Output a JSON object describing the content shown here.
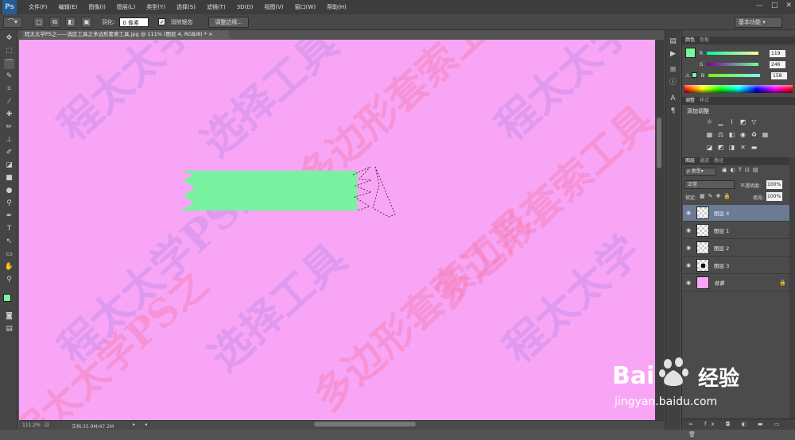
{
  "app": {
    "logo": "Ps"
  },
  "menu": [
    "文件(F)",
    "编辑(E)",
    "图像(I)",
    "图层(L)",
    "类型(Y)",
    "选择(S)",
    "滤镜(T)",
    "3D(D)",
    "视图(V)",
    "窗口(W)",
    "帮助(H)"
  ],
  "window_controls": [
    "—",
    "□",
    "✕"
  ],
  "options": {
    "feather_label": "羽化:",
    "feather_value": "0 像素",
    "antialias_label": "消除锯齿",
    "antialias_checked": true,
    "refine_edge_button": "调整边缘...",
    "workspace": "基本功能"
  },
  "document": {
    "tab_title": "程太太学PS之——选区工具之多边形套索工具.jpg @ 111% (图层 4, RGB/8) *",
    "close_icon": "×"
  },
  "canvas": {
    "background_color": "#f8a5f5",
    "shape_color": "#78f2a0",
    "watermark_texts": [
      "程太太学",
      "选择工具",
      "多边形套索工具",
      "程太太学PS之",
      "程太太学",
      "选择工具",
      "多边形套索工具",
      "程太太学",
      "多边形套索工具",
      "程太太学PS之"
    ]
  },
  "status": {
    "zoom": "111.2%",
    "doc_info": "文档:35.9M/47.2M"
  },
  "color_panel": {
    "tabs": [
      "颜色",
      "色板"
    ],
    "R": "119",
    "G": "246",
    "B": "158",
    "foreground": "#77f69e",
    "r_label": "R",
    "g_label": "G",
    "b_label": "B"
  },
  "adjust_panel": {
    "tabs": [
      "调整",
      "样式"
    ],
    "title": "添加调整"
  },
  "layers_panel": {
    "tabs": [
      "图层",
      "通道",
      "路径"
    ],
    "filter": "ρ 类型",
    "blend_mode": "正常",
    "opacity_label": "不透明度:",
    "opacity_value": "100%",
    "lock_label": "锁定:",
    "fill_label": "填充:",
    "fill_value": "100%",
    "layers": [
      {
        "name": "图层 4",
        "selected": true
      },
      {
        "name": "图层 1",
        "selected": false
      },
      {
        "name": "图层 2",
        "selected": false
      },
      {
        "name": "图层 3",
        "selected": false
      },
      {
        "name": "背景",
        "selected": false
      }
    ]
  },
  "watermark": {
    "brand": "Bai",
    "brand2": "du",
    "product": "经验",
    "url": "jingyan.baidu.com"
  }
}
